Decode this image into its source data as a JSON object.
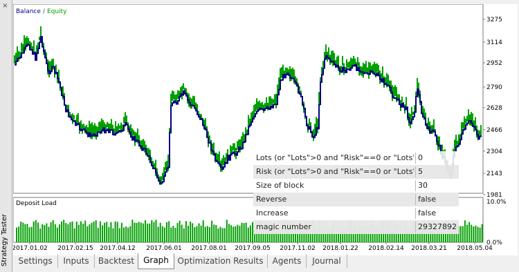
{
  "window": {
    "side_title": "Strategy Tester",
    "close_glyph": "×"
  },
  "balance_chart": {
    "legend_balance": "Balance",
    "legend_sep": "/",
    "legend_equity": "Equity",
    "y_ticks": [
      "3275",
      "3114",
      "2952",
      "2790",
      "2628",
      "2466",
      "2304",
      "2143",
      "1981"
    ],
    "colors": {
      "balance": "#000080",
      "equity": "#00a000"
    }
  },
  "deposit_chart": {
    "title": "Deposit Load",
    "y_ticks": [
      "10.0%",
      "0.0%"
    ]
  },
  "x_ticks": [
    "2017.01.02",
    "2017.02.15",
    "2017.04.12",
    "2017.06.01",
    "2017.08.01",
    "2017.09.05",
    "2017.11.02",
    "2018.01.22",
    "2018.02.14",
    "2018.03.21",
    "2018.05.04"
  ],
  "parameters": [
    {
      "name": "Lots (or \"Lots\">0 and \"Risk\"==0 or \"Lots\"...",
      "value": "0"
    },
    {
      "name": "Risk (or \"Lots\">0 and \"Risk\"==0 or \"Lots\"...",
      "value": "5"
    },
    {
      "name": "Size of block",
      "value": "30"
    },
    {
      "name": "Reverse",
      "value": "false"
    },
    {
      "name": "Increase",
      "value": "false"
    },
    {
      "name": "magic number",
      "value": "29327892"
    }
  ],
  "tabs": [
    "Settings",
    "Inputs",
    "Backtest",
    "Graph",
    "Optimization Results",
    "Agents",
    "Journal"
  ],
  "active_tab": "Graph"
}
